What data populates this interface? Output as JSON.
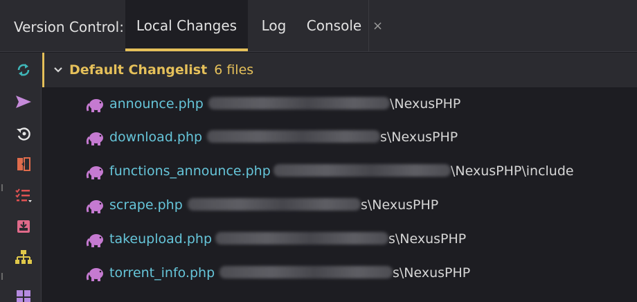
{
  "header": {
    "title": "Version Control:",
    "tabs": [
      {
        "label": "Local Changes",
        "active": true
      },
      {
        "label": "Log",
        "active": false
      },
      {
        "label": "Console",
        "active": false
      }
    ],
    "close_glyph": "×"
  },
  "toolbar": {
    "buttons": [
      {
        "icon": "refresh-icon",
        "color": "#3fb6b8"
      },
      {
        "icon": "commit-arrow-icon",
        "color": "#c58ad9"
      },
      {
        "icon": "rollback-icon",
        "color": "#e6e6e6"
      },
      {
        "icon": "diff-icon",
        "color": "#e06c4c"
      },
      {
        "icon": "group-by-icon",
        "color": "#e05252"
      },
      {
        "icon": "shelve-icon",
        "color": "#e06a8a"
      },
      {
        "icon": "hierarchy-icon",
        "color": "#e0c84a"
      },
      {
        "icon": "layout-icon",
        "color": "#b58ae0"
      }
    ]
  },
  "changelist": {
    "name": "Default Changelist",
    "count": "6 files",
    "files": [
      {
        "name": "announce.php",
        "path_suffix": "\\NexusPHP"
      },
      {
        "name": "download.php",
        "path_suffix": "s\\NexusPHP"
      },
      {
        "name": "functions_announce.php",
        "path_suffix": "\\NexusPHP\\include"
      },
      {
        "name": "scrape.php",
        "path_suffix": "s\\NexusPHP"
      },
      {
        "name": "takeupload.php",
        "path_suffix": "s\\NexusPHP"
      },
      {
        "name": "torrent_info.php",
        "path_suffix": "s\\NexusPHP"
      }
    ]
  },
  "colors": {
    "accent": "#e5c05a",
    "file_name": "#66c5d9",
    "php_icon": "#c57ad1"
  }
}
